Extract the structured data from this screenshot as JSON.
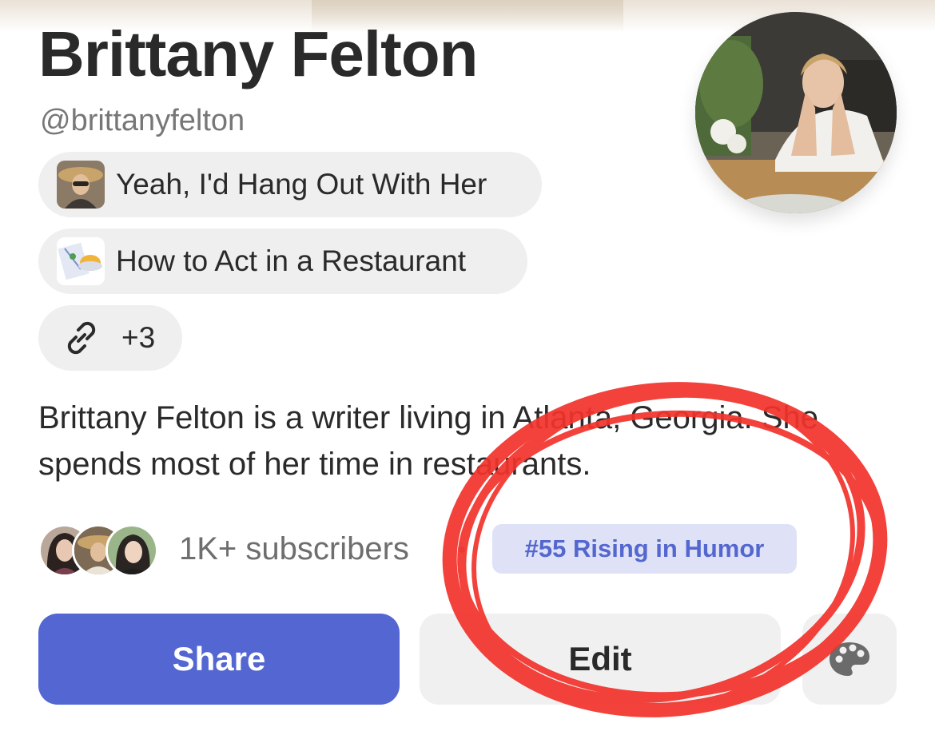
{
  "profile": {
    "name": "Brittany Felton",
    "handle": "@brittanyfelton",
    "bio": "Brittany Felton is a writer living in Atlanta, Georgia. She spends most of her time in restaurants."
  },
  "publications": [
    {
      "label": "Yeah, I'd Hang Out With Her",
      "icon": "publication-thumbnail"
    },
    {
      "label": "How to Act in a Restaurant",
      "icon": "publication-thumbnail"
    }
  ],
  "links": {
    "icon": "link-icon",
    "more_label": "+3"
  },
  "subscribers": {
    "count_label": "1K+ subscribers"
  },
  "ranking": {
    "label": "#55 Rising in Humor"
  },
  "actions": {
    "share_label": "Share",
    "edit_label": "Edit",
    "theme_icon": "palette-icon"
  },
  "colors": {
    "accent": "#5366d1",
    "badge_bg": "#dfe2f7",
    "badge_text": "#5467cf",
    "annotation": "#f2332b"
  }
}
